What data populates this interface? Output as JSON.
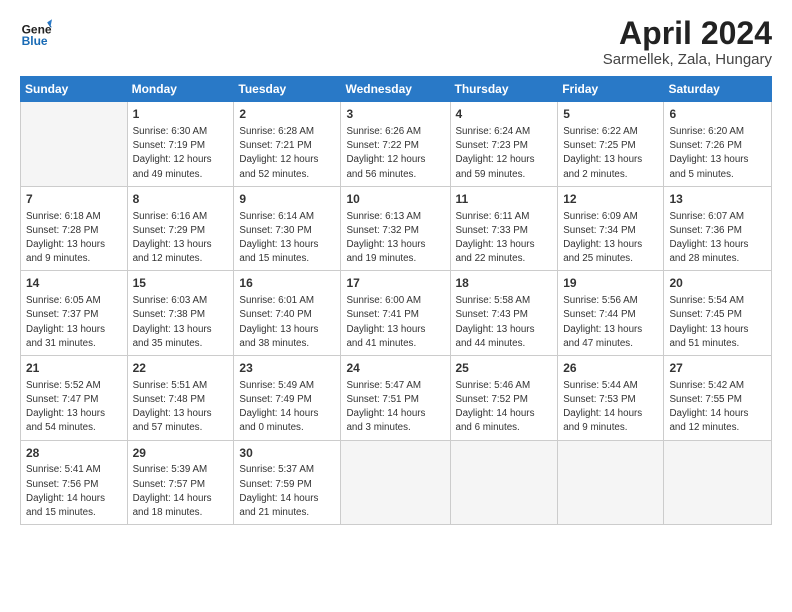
{
  "header": {
    "logo_line1": "General",
    "logo_line2": "Blue",
    "title": "April 2024",
    "subtitle": "Sarmellek, Zala, Hungary"
  },
  "calendar": {
    "days_of_week": [
      "Sunday",
      "Monday",
      "Tuesday",
      "Wednesday",
      "Thursday",
      "Friday",
      "Saturday"
    ],
    "weeks": [
      [
        {
          "day": "",
          "info": ""
        },
        {
          "day": "1",
          "info": "Sunrise: 6:30 AM\nSunset: 7:19 PM\nDaylight: 12 hours\nand 49 minutes."
        },
        {
          "day": "2",
          "info": "Sunrise: 6:28 AM\nSunset: 7:21 PM\nDaylight: 12 hours\nand 52 minutes."
        },
        {
          "day": "3",
          "info": "Sunrise: 6:26 AM\nSunset: 7:22 PM\nDaylight: 12 hours\nand 56 minutes."
        },
        {
          "day": "4",
          "info": "Sunrise: 6:24 AM\nSunset: 7:23 PM\nDaylight: 12 hours\nand 59 minutes."
        },
        {
          "day": "5",
          "info": "Sunrise: 6:22 AM\nSunset: 7:25 PM\nDaylight: 13 hours\nand 2 minutes."
        },
        {
          "day": "6",
          "info": "Sunrise: 6:20 AM\nSunset: 7:26 PM\nDaylight: 13 hours\nand 5 minutes."
        }
      ],
      [
        {
          "day": "7",
          "info": "Sunrise: 6:18 AM\nSunset: 7:28 PM\nDaylight: 13 hours\nand 9 minutes."
        },
        {
          "day": "8",
          "info": "Sunrise: 6:16 AM\nSunset: 7:29 PM\nDaylight: 13 hours\nand 12 minutes."
        },
        {
          "day": "9",
          "info": "Sunrise: 6:14 AM\nSunset: 7:30 PM\nDaylight: 13 hours\nand 15 minutes."
        },
        {
          "day": "10",
          "info": "Sunrise: 6:13 AM\nSunset: 7:32 PM\nDaylight: 13 hours\nand 19 minutes."
        },
        {
          "day": "11",
          "info": "Sunrise: 6:11 AM\nSunset: 7:33 PM\nDaylight: 13 hours\nand 22 minutes."
        },
        {
          "day": "12",
          "info": "Sunrise: 6:09 AM\nSunset: 7:34 PM\nDaylight: 13 hours\nand 25 minutes."
        },
        {
          "day": "13",
          "info": "Sunrise: 6:07 AM\nSunset: 7:36 PM\nDaylight: 13 hours\nand 28 minutes."
        }
      ],
      [
        {
          "day": "14",
          "info": "Sunrise: 6:05 AM\nSunset: 7:37 PM\nDaylight: 13 hours\nand 31 minutes."
        },
        {
          "day": "15",
          "info": "Sunrise: 6:03 AM\nSunset: 7:38 PM\nDaylight: 13 hours\nand 35 minutes."
        },
        {
          "day": "16",
          "info": "Sunrise: 6:01 AM\nSunset: 7:40 PM\nDaylight: 13 hours\nand 38 minutes."
        },
        {
          "day": "17",
          "info": "Sunrise: 6:00 AM\nSunset: 7:41 PM\nDaylight: 13 hours\nand 41 minutes."
        },
        {
          "day": "18",
          "info": "Sunrise: 5:58 AM\nSunset: 7:43 PM\nDaylight: 13 hours\nand 44 minutes."
        },
        {
          "day": "19",
          "info": "Sunrise: 5:56 AM\nSunset: 7:44 PM\nDaylight: 13 hours\nand 47 minutes."
        },
        {
          "day": "20",
          "info": "Sunrise: 5:54 AM\nSunset: 7:45 PM\nDaylight: 13 hours\nand 51 minutes."
        }
      ],
      [
        {
          "day": "21",
          "info": "Sunrise: 5:52 AM\nSunset: 7:47 PM\nDaylight: 13 hours\nand 54 minutes."
        },
        {
          "day": "22",
          "info": "Sunrise: 5:51 AM\nSunset: 7:48 PM\nDaylight: 13 hours\nand 57 minutes."
        },
        {
          "day": "23",
          "info": "Sunrise: 5:49 AM\nSunset: 7:49 PM\nDaylight: 14 hours\nand 0 minutes."
        },
        {
          "day": "24",
          "info": "Sunrise: 5:47 AM\nSunset: 7:51 PM\nDaylight: 14 hours\nand 3 minutes."
        },
        {
          "day": "25",
          "info": "Sunrise: 5:46 AM\nSunset: 7:52 PM\nDaylight: 14 hours\nand 6 minutes."
        },
        {
          "day": "26",
          "info": "Sunrise: 5:44 AM\nSunset: 7:53 PM\nDaylight: 14 hours\nand 9 minutes."
        },
        {
          "day": "27",
          "info": "Sunrise: 5:42 AM\nSunset: 7:55 PM\nDaylight: 14 hours\nand 12 minutes."
        }
      ],
      [
        {
          "day": "28",
          "info": "Sunrise: 5:41 AM\nSunset: 7:56 PM\nDaylight: 14 hours\nand 15 minutes."
        },
        {
          "day": "29",
          "info": "Sunrise: 5:39 AM\nSunset: 7:57 PM\nDaylight: 14 hours\nand 18 minutes."
        },
        {
          "day": "30",
          "info": "Sunrise: 5:37 AM\nSunset: 7:59 PM\nDaylight: 14 hours\nand 21 minutes."
        },
        {
          "day": "",
          "info": ""
        },
        {
          "day": "",
          "info": ""
        },
        {
          "day": "",
          "info": ""
        },
        {
          "day": "",
          "info": ""
        }
      ]
    ]
  }
}
